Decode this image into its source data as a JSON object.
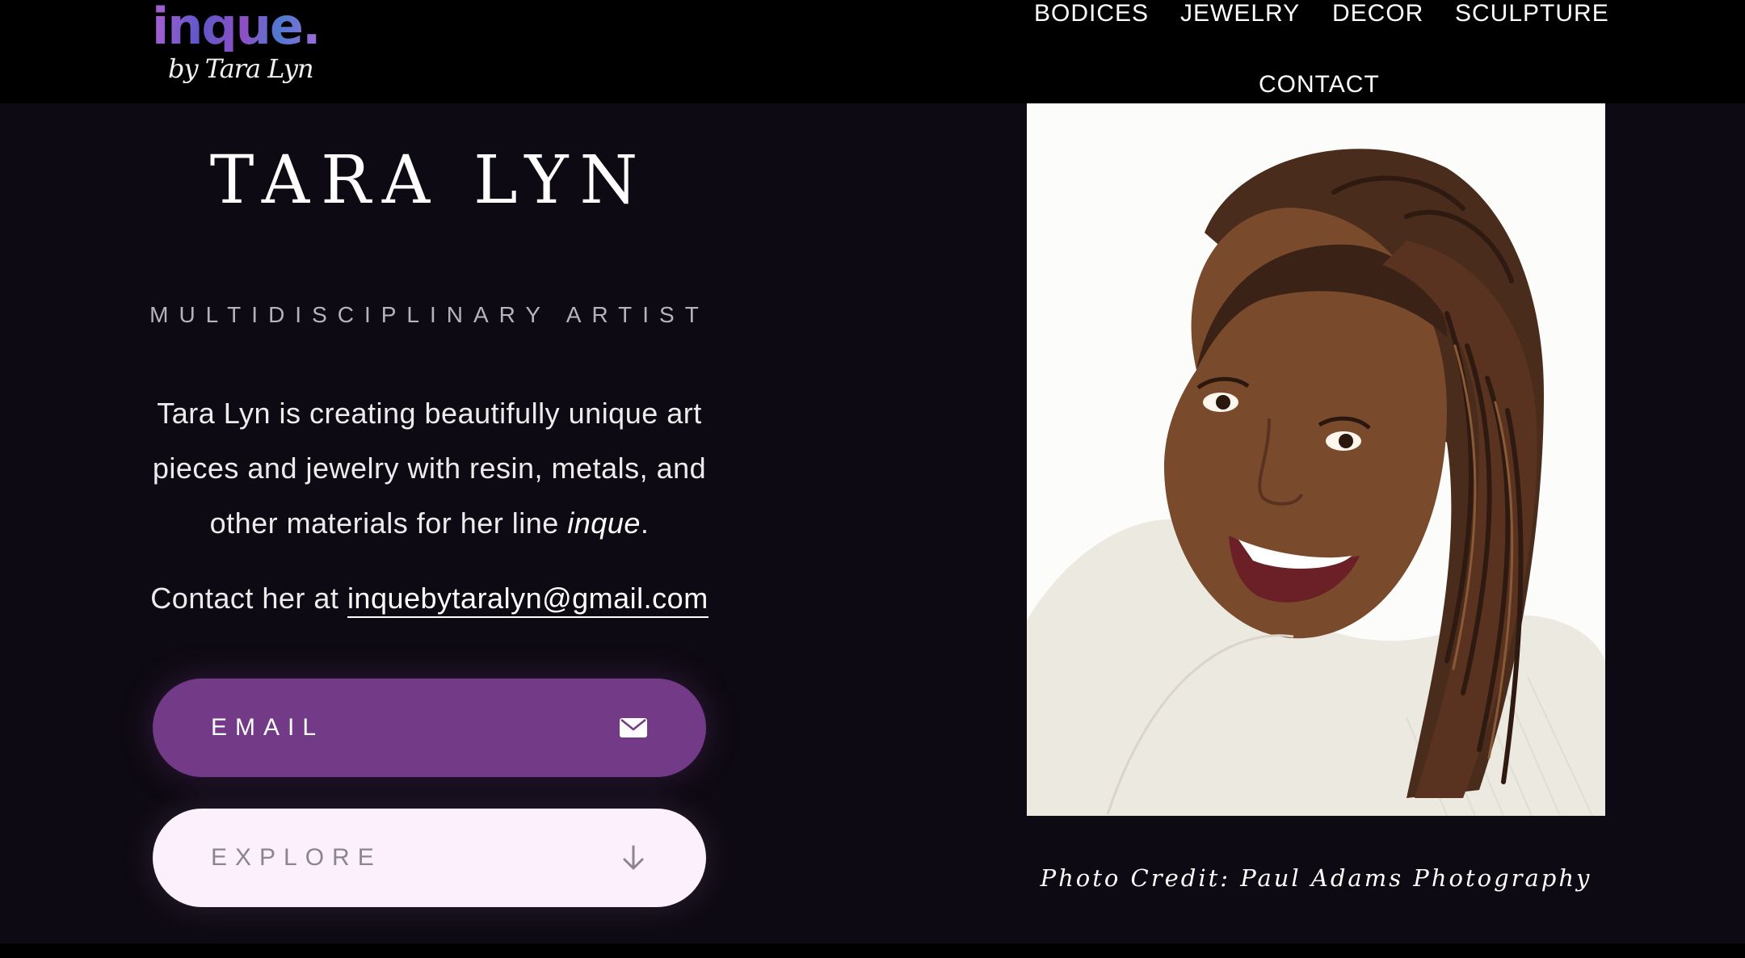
{
  "header": {
    "logo": {
      "main": "inque.",
      "sub": "by Tara Lyn"
    },
    "nav": [
      {
        "label": "BODICES"
      },
      {
        "label": "JEWELRY"
      },
      {
        "label": "DECOR"
      },
      {
        "label": "SCULPTURE"
      },
      {
        "label": "CONTACT"
      }
    ]
  },
  "hero": {
    "name": "TARA LYN",
    "tagline": "MULTIDISCIPLINARY ARTIST",
    "description_before": "Tara Lyn is creating beautifully unique art pieces and jewelry with resin, metals, and other materials for her line ",
    "description_brand": "inque",
    "description_after": ".",
    "contact_prefix": "Contact her at ",
    "contact_email": "inquebytaralyn@gmail.com",
    "buttons": {
      "email": {
        "label": "EMAIL",
        "icon": "envelope-icon"
      },
      "explore": {
        "label": "EXPLORE",
        "icon": "arrow-down-icon"
      }
    }
  },
  "portrait": {
    "credit": "Photo Credit: Paul Adams Photography"
  },
  "colors": {
    "background": "#0e0a13",
    "nav_background": "#000000",
    "email_button": "#733a87",
    "explore_button": "#fbf0fc"
  }
}
